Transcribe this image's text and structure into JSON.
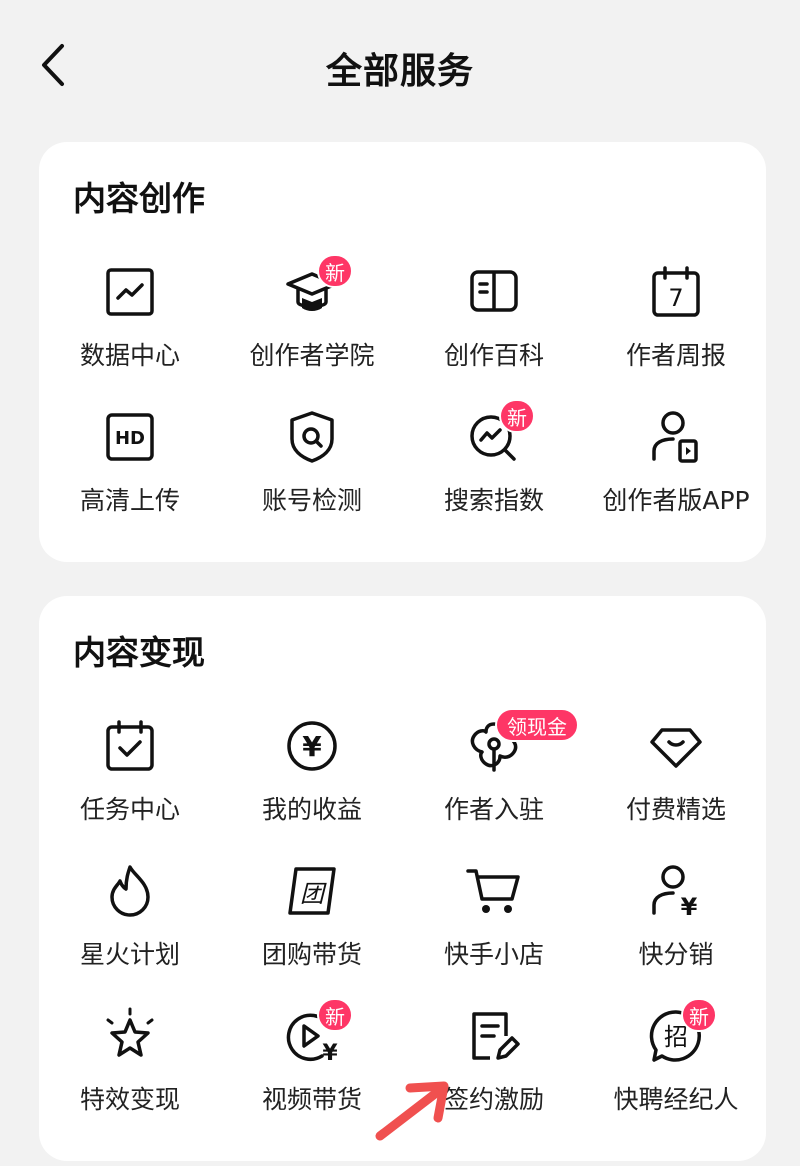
{
  "header": {
    "title": "全部服务"
  },
  "sections": [
    {
      "title": "内容创作",
      "items": [
        {
          "label": "数据中心"
        },
        {
          "label": "创作者学院",
          "badge": "新"
        },
        {
          "label": "创作百科"
        },
        {
          "label": "作者周报",
          "icon_text": "7"
        },
        {
          "label": "高清上传",
          "icon_text": "HD"
        },
        {
          "label": "账号检测"
        },
        {
          "label": "搜索指数",
          "badge": "新"
        },
        {
          "label": "创作者版APP"
        }
      ]
    },
    {
      "title": "内容变现",
      "items": [
        {
          "label": "任务中心"
        },
        {
          "label": "我的收益",
          "icon_text": "¥"
        },
        {
          "label": "作者入驻",
          "badge": "领现金"
        },
        {
          "label": "付费精选"
        },
        {
          "label": "星火计划"
        },
        {
          "label": "团购带货",
          "icon_text": "团"
        },
        {
          "label": "快手小店"
        },
        {
          "label": "快分销",
          "icon_text": "¥"
        },
        {
          "label": "特效变现"
        },
        {
          "label": "视频带货",
          "badge": "新",
          "icon_text": "¥"
        },
        {
          "label": "签约激励"
        },
        {
          "label": "快聘经纪人",
          "badge": "新",
          "icon_text": "招"
        }
      ]
    }
  ],
  "colors": {
    "badge": "#fe3666",
    "annotation_arrow": "#f0504f",
    "card": "#ffffff",
    "background": "#f2f2f2"
  }
}
